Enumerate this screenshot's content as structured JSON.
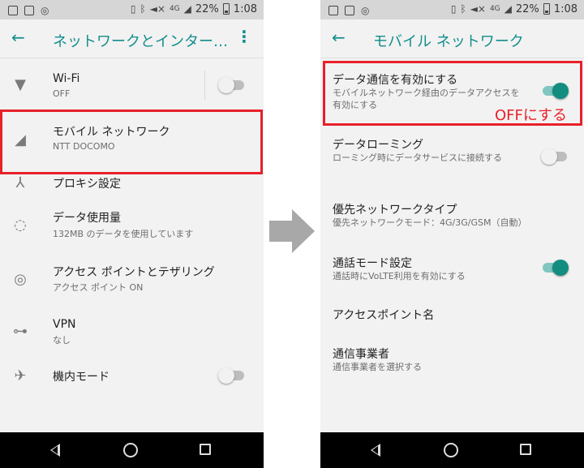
{
  "status_bar": {
    "battery": "22%",
    "time": "1:08",
    "network": "4G"
  },
  "left": {
    "title": "ネットワークとインター…",
    "items": [
      {
        "title": "Wi-Fi",
        "subtitle": "OFF",
        "icon": "wifi-icon"
      },
      {
        "title": "モバイル ネットワーク",
        "subtitle": "NTT DOCOMO",
        "icon": "cellular-signal-icon"
      },
      {
        "title": "プロキシ設定",
        "subtitle": "",
        "icon": "proxy-icon"
      },
      {
        "title": "データ使用量",
        "subtitle": "132MB のデータを使用しています",
        "icon": "data-usage-icon"
      },
      {
        "title": "アクセス ポイントとテザリング",
        "subtitle": "アクセス ポイント ON",
        "icon": "hotspot-icon"
      },
      {
        "title": "VPN",
        "subtitle": "なし",
        "icon": "vpn-key-icon"
      },
      {
        "title": "機内モード",
        "subtitle": "",
        "icon": "airplane-icon"
      }
    ],
    "wifi_toggle_on": false,
    "airplane_toggle_on": false
  },
  "right": {
    "title": "モバイル ネットワーク",
    "items": [
      {
        "title": "データ通信を有効にする",
        "subtitle": "モバイルネットワーク経由のデータアクセスを有効にする",
        "toggle_on": true
      },
      {
        "title": "データローミング",
        "subtitle": "ローミング時にデータサービスに接続する",
        "toggle_on": false
      },
      {
        "title": "優先ネットワークタイプ",
        "subtitle": "優先ネットワークモード：4G/3G/GSM（自動）"
      },
      {
        "title": "通話モード設定",
        "subtitle": "通話時にVoLTE利用を有効にする",
        "toggle_on": true
      },
      {
        "title": "アクセスポイント名",
        "subtitle": ""
      },
      {
        "title": "通信事業者",
        "subtitle": "通信事業者を選択する"
      }
    ]
  },
  "annotation": {
    "off_label": "OFFにする",
    "highlight_color": "#e8202a"
  },
  "colors": {
    "accent": "#138d8d",
    "toggle_on": "#138d80",
    "arrow": "#a8a8a8"
  }
}
